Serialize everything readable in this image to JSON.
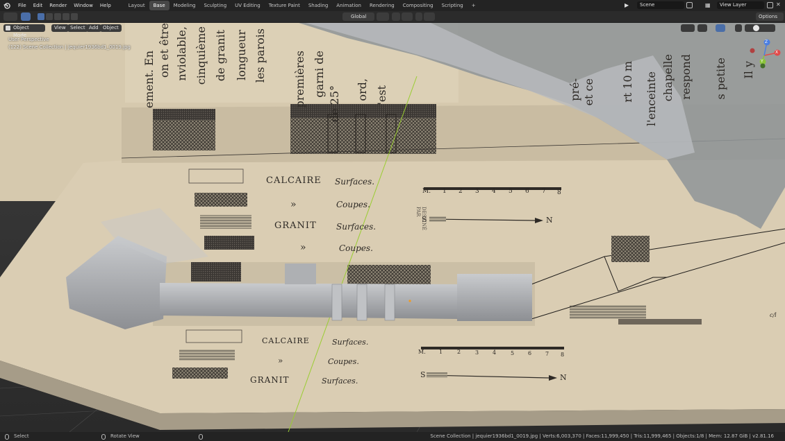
{
  "topbar": {
    "menus": [
      "File",
      "Edit",
      "Render",
      "Window",
      "Help"
    ],
    "workspaces": [
      "Layout",
      "Base",
      "Modeling",
      "Sculpting",
      "UV Editing",
      "Texture Paint",
      "Shading",
      "Animation",
      "Rendering",
      "Compositing",
      "Scripting"
    ],
    "active_workspace": "Base",
    "add_tab": "+",
    "scene": "Scene",
    "view_layer": "View Layer"
  },
  "header": {
    "transform_orientation": "Global",
    "options": "Options"
  },
  "viewport_header": {
    "mode": "Object Mode",
    "menus": [
      "View",
      "Select",
      "Add",
      "Object"
    ]
  },
  "viewport": {
    "perspective": "User Perspective",
    "collection_info": "(122) Scene Collection | jequier1936bd1_0019.jpg",
    "gizmo": {
      "x": "X",
      "y": "Y",
      "z": "Z"
    }
  },
  "document": {
    "vertical_text": [
      "ement. En",
      "on et être",
      "nviolable,",
      "cinquième",
      "de granit",
      "longueur",
      "les parois",
      "garni de",
      "de 25°",
      "premières",
      "ord,",
      "'est",
      "et ce",
      "l'enceinte",
      "chapelle",
      "respond",
      "s petite",
      "Il y",
      "pré-",
      "rt 10 m"
    ],
    "upper": {
      "limestone": "CALCAIRE",
      "granite": "GRANIT",
      "surfaces": "Surfaces.",
      "ditto": "»",
      "sections": "Coupes.",
      "scale_m": "M.",
      "scale_numbers": [
        "1",
        "2",
        "3",
        "4",
        "5",
        "6",
        "7",
        "8"
      ],
      "south": "S",
      "north": "N"
    },
    "lower": {
      "limestone": "CALCAIRE",
      "granite": "GRANIT",
      "surfaces": "Surfaces.",
      "ditto": "»",
      "sections": "Coupes.",
      "scale_m": "M.",
      "scale_numbers": [
        "1",
        "2",
        "3",
        "4",
        "5",
        "6",
        "7",
        "8"
      ],
      "south": "S",
      "north": "N"
    },
    "side_label": "DESSINÉ PAR",
    "page_marker": "c/l"
  },
  "statusbar": {
    "select": "Select",
    "rotate": "Rotate View",
    "stats": "Scene Collection | jequier1936bd1_0019.jpg | Verts:6,003,370 | Faces:11,999,450 | Tris:11,999,465 | Objects:1/8 | Mem: 12.87 GiB | v2.81.16"
  },
  "colors": {
    "topbar": "#232323",
    "header": "#2b2b2b",
    "active_tab": "#474747",
    "paper": "#d9ccb2",
    "ink": "#3a3632",
    "mesh": "#9ea0a3",
    "accent_blue": "#4a6ea8",
    "axis_green": "#9acd32"
  },
  "icons": [
    "blender-logo-icon",
    "editor-type-icon",
    "select-box-icon",
    "object-mode-icon",
    "scene-icon",
    "view-layer-icon",
    "mouse-left-icon",
    "mouse-middle-icon",
    "mouse-right-icon",
    "snap-icon",
    "proportional-icon",
    "viewport-shading-icon",
    "overlay-icon"
  ]
}
